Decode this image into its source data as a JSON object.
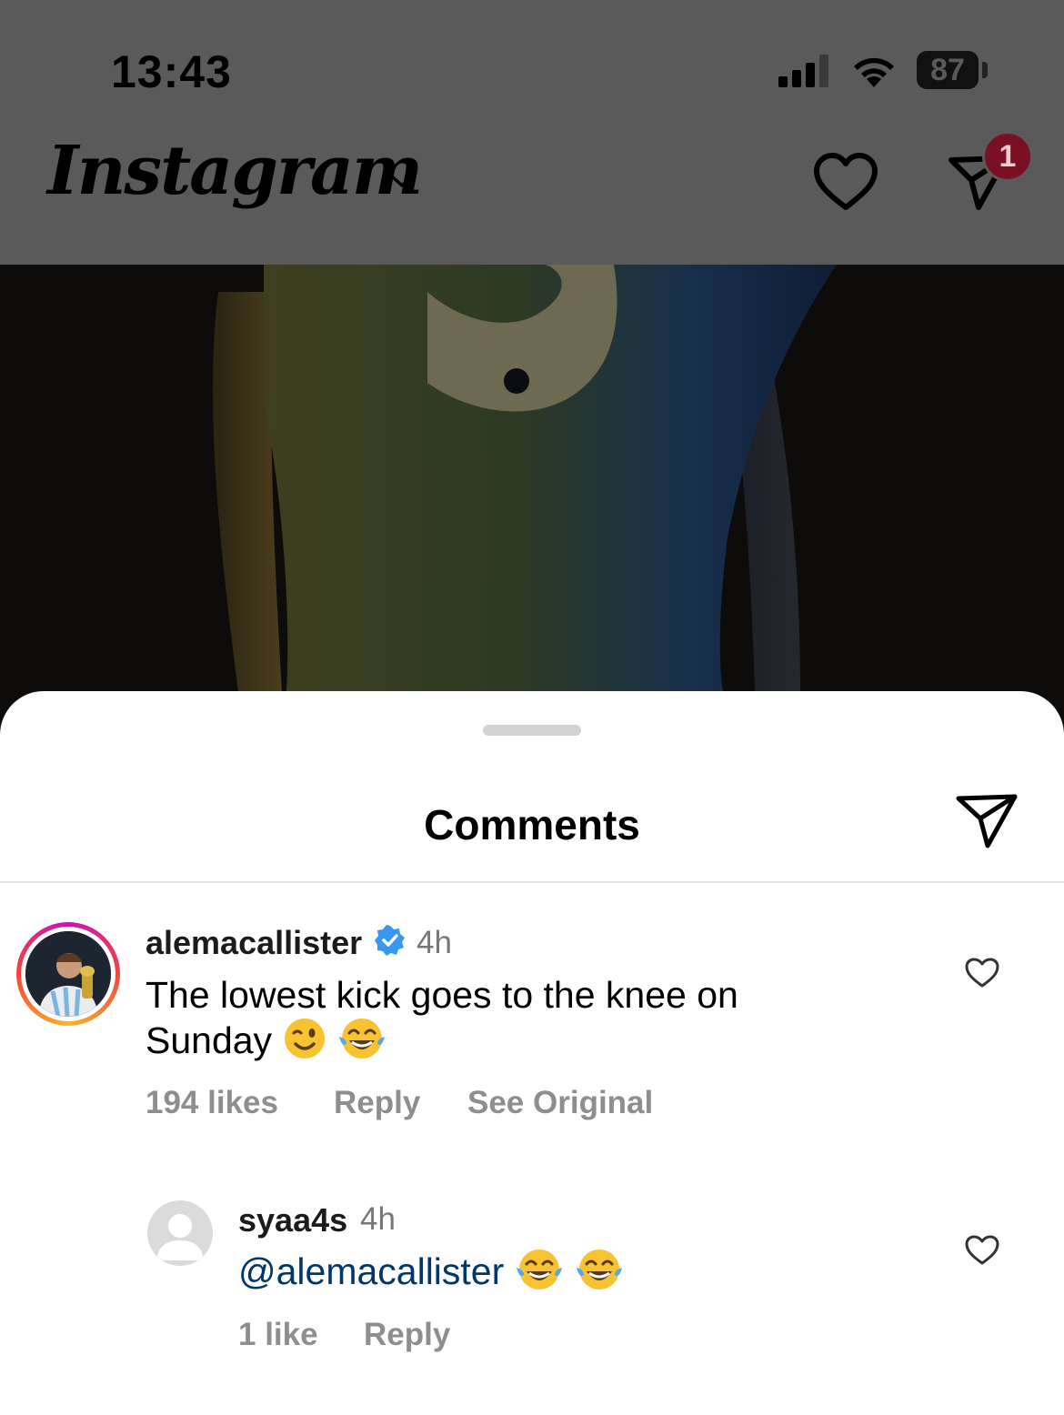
{
  "status_bar": {
    "time": "13:43",
    "battery": "87"
  },
  "header": {
    "app_name": "Instagram",
    "dm_badge_count": "1"
  },
  "sheet": {
    "title": "Comments",
    "comments": [
      {
        "username": "alemacallister",
        "verified": true,
        "time": "4h",
        "text": "The lowest kick goes to the knee on Sunday",
        "emojis": [
          "winking-face",
          "tears-of-joy"
        ],
        "likes": "194 likes",
        "reply": "Reply",
        "see_original": "See Original"
      },
      {
        "username": "syaa4s",
        "time": "4h",
        "mention": "@alemacallister",
        "emojis": [
          "tears-of-joy",
          "tears-of-joy"
        ],
        "likes": "1 like",
        "reply": "Reply"
      }
    ]
  },
  "colors": {
    "dim_overlay": "#5a5a5a",
    "badge": "#7a1024",
    "mention": "#00376b",
    "verified": "#3897f0",
    "meta_gray": "#8e8e8e"
  }
}
